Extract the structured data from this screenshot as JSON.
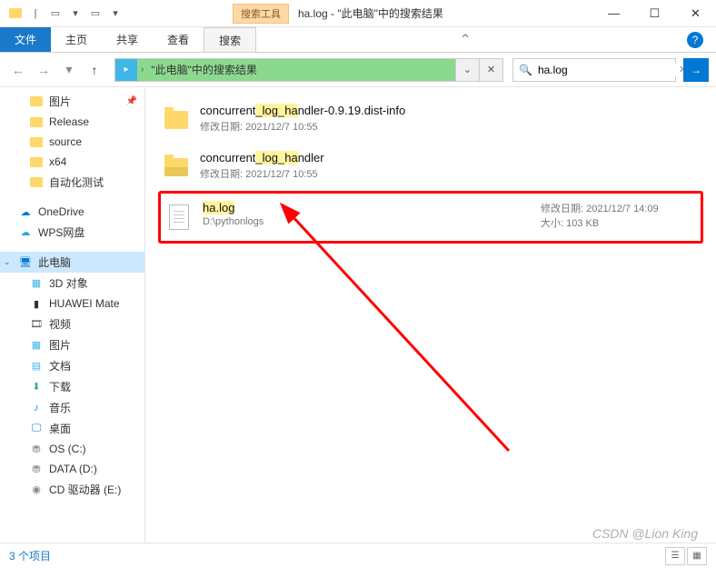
{
  "window": {
    "context_tab": "搜索工具",
    "title": "ha.log - \"此电脑\"中的搜索结果"
  },
  "ribbon": {
    "file": "文件",
    "tabs": [
      "主页",
      "共享",
      "查看",
      "搜索"
    ],
    "active_index": 3
  },
  "nav": {
    "address": "\"此电脑\"中的搜索结果",
    "search_value": "ha.log"
  },
  "sidebar": {
    "quick": [
      {
        "label": "图片",
        "pinned": true,
        "icon": "folder"
      },
      {
        "label": "Release",
        "icon": "folder"
      },
      {
        "label": "source",
        "icon": "folder"
      },
      {
        "label": "x64",
        "icon": "folder"
      },
      {
        "label": "自动化测试",
        "icon": "folder"
      }
    ],
    "cloud": [
      {
        "label": "OneDrive",
        "icon": "onedrive"
      },
      {
        "label": "WPS网盘",
        "icon": "wps"
      }
    ],
    "pc_label": "此电脑",
    "pc_items": [
      {
        "label": "3D 对象",
        "icon": "3d"
      },
      {
        "label": "HUAWEI Mate",
        "icon": "phone"
      },
      {
        "label": "视频",
        "icon": "video"
      },
      {
        "label": "图片",
        "icon": "pictures"
      },
      {
        "label": "文档",
        "icon": "docs"
      },
      {
        "label": "下载",
        "icon": "downloads"
      },
      {
        "label": "音乐",
        "icon": "music"
      },
      {
        "label": "桌面",
        "icon": "desktop"
      },
      {
        "label": "OS (C:)",
        "icon": "drive"
      },
      {
        "label": "DATA (D:)",
        "icon": "drive"
      },
      {
        "label": "CD 驱动器 (E:)",
        "icon": "cd"
      }
    ]
  },
  "results": [
    {
      "name_parts": [
        "concurrent",
        "_log_",
        "ha",
        "ndler-0.9.19.dist-info"
      ],
      "hl": [
        false,
        true,
        true,
        false
      ],
      "meta_label": "修改日期:",
      "meta_value": "2021/12/7 10:55",
      "icon": "folder"
    },
    {
      "name_parts": [
        "concurrent",
        "_log_",
        "ha",
        "ndler"
      ],
      "hl": [
        false,
        true,
        true,
        false
      ],
      "meta_label": "修改日期:",
      "meta_value": "2021/12/7 10:55",
      "icon": "folder-py"
    },
    {
      "name_parts": [
        "ha",
        ".log"
      ],
      "hl": [
        true,
        true
      ],
      "path": "D:\\pythonlogs",
      "side": [
        {
          "label": "修改日期:",
          "value": "2021/12/7 14:09"
        },
        {
          "label": "大小:",
          "value": "103 KB"
        }
      ],
      "icon": "file",
      "boxed": true
    }
  ],
  "status": {
    "count": "3 个项目"
  },
  "watermark": "CSDN @Lion King"
}
